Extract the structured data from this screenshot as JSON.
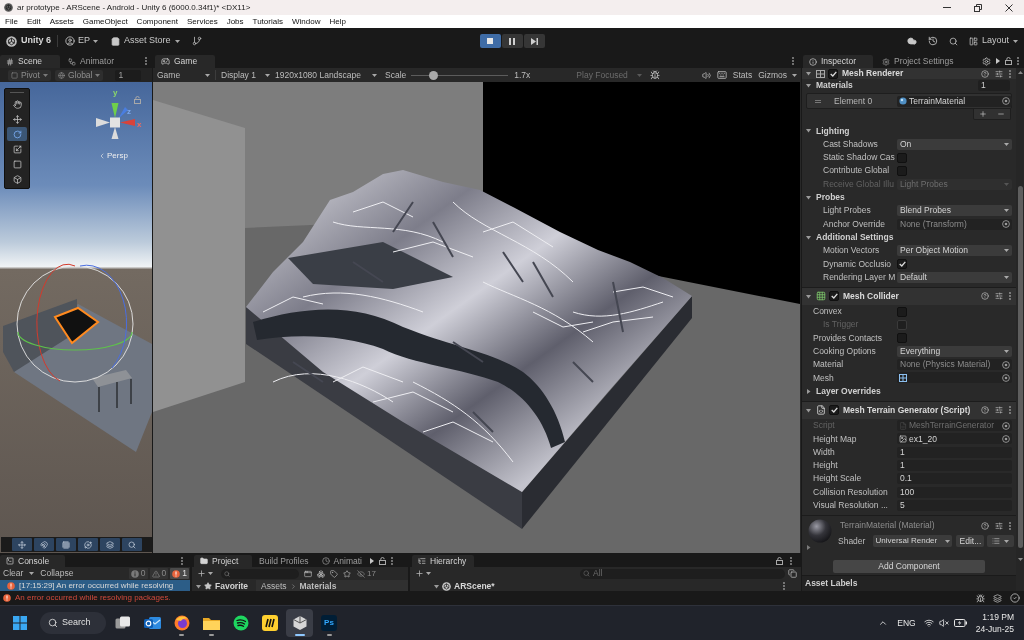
{
  "window": {
    "title": "ar prototype - ARScene - Android - Unity 6 (6000.0.34f1)* <DX11>"
  },
  "menu": [
    "File",
    "Edit",
    "Assets",
    "GameObject",
    "Component",
    "Services",
    "Jobs",
    "Tutorials",
    "Window",
    "Help"
  ],
  "toolbar": {
    "product": "Unity 6",
    "account": "EP",
    "store": "Asset Store",
    "play_controls": [
      {
        "kind": "play",
        "selected": true
      },
      {
        "kind": "pause",
        "selected": false
      },
      {
        "kind": "step",
        "selected": false
      }
    ],
    "layout": "Layout"
  },
  "scene": {
    "tabs": [
      {
        "label": "Scene",
        "kind": "scene",
        "selected": true
      },
      {
        "label": "Animator",
        "kind": "animator",
        "selected": false
      }
    ],
    "pivot": "Pivot",
    "space": "Global",
    "grid_size": "1",
    "tools": [
      {
        "kind": "hand",
        "selected": false
      },
      {
        "kind": "move",
        "selected": false
      },
      {
        "kind": "rotate",
        "selected": true
      },
      {
        "kind": "scale",
        "selected": false
      },
      {
        "kind": "rect",
        "selected": false
      },
      {
        "kind": "transform",
        "selected": false
      }
    ],
    "axis_labels": [
      "y",
      "z",
      "x"
    ],
    "projection": "Persp"
  },
  "game": {
    "tab": {
      "label": "Game",
      "selected": true
    },
    "mode": "Game",
    "display": "Display 1",
    "resolution": "1920x1080 Landscape",
    "scale": {
      "label": "Scale",
      "level": 0.2,
      "reading": "1.7x"
    },
    "play_focused": "Play Focused",
    "stats": "Stats",
    "gizmos": "Gizmos"
  },
  "inspector": {
    "tabs": [
      {
        "label": "Inspector",
        "kind": "info",
        "selected": true
      },
      {
        "label": "Project Settings",
        "kind": "settings",
        "selected": false
      }
    ],
    "components": [
      {
        "name": "Mesh Renderer",
        "kind": "renderer",
        "expanded": true,
        "enabled": true,
        "rows": [
          {
            "kind": "array",
            "label": "Materials",
            "value": "1",
            "expanded": true,
            "children": [
              {
                "kind": "material",
                "label": "Element 0",
                "value": "TerrainMaterial"
              }
            ]
          },
          {
            "kind": "section",
            "label": "Lighting",
            "expanded": true,
            "children": [
              {
                "kind": "dropdown",
                "label": "Cast Shadows",
                "value": "On",
                "disabled": false
              },
              {
                "kind": "checkbox",
                "label": "Static Shadow Cas",
                "checked": false,
                "disabled": false
              },
              {
                "kind": "checkbox",
                "label": "Contribute Global",
                "checked": false,
                "disabled": false
              },
              {
                "kind": "dropdown",
                "label": "Receive Global Illu",
                "value": "Light Probes",
                "disabled": true
              }
            ]
          },
          {
            "kind": "section",
            "label": "Probes",
            "expanded": true,
            "children": [
              {
                "kind": "dropdown",
                "label": "Light Probes",
                "value": "Blend Probes",
                "disabled": false
              },
              {
                "kind": "object",
                "label": "Anchor Override",
                "value": "None (Transform)",
                "disabled": false
              }
            ]
          },
          {
            "kind": "section",
            "label": "Additional Settings",
            "expanded": true,
            "children": [
              {
                "kind": "dropdown",
                "label": "Motion Vectors",
                "value": "Per Object Motion",
                "disabled": false
              },
              {
                "kind": "checkbox",
                "label": "Dynamic Occlusio",
                "checked": true,
                "disabled": false
              },
              {
                "kind": "dropdown",
                "label": "Rendering Layer M",
                "value": "Default",
                "disabled": false
              }
            ]
          }
        ]
      },
      {
        "name": "Mesh Collider",
        "kind": "collider",
        "expanded": true,
        "enabled": true,
        "rows": [
          {
            "kind": "checkbox",
            "label": "Convex",
            "checked": false,
            "disabled": false,
            "children": [
              {
                "kind": "checkbox",
                "label": "Is Trigger",
                "checked": false,
                "disabled": true
              }
            ]
          },
          {
            "kind": "checkbox",
            "label": "Provides Contacts",
            "checked": false,
            "disabled": false
          },
          {
            "kind": "dropdown",
            "label": "Cooking Options",
            "value": "Everything",
            "disabled": false
          },
          {
            "kind": "object",
            "label": "Material",
            "value": "None (Physics Material)",
            "disabled": false
          },
          {
            "kind": "mesh",
            "label": "Mesh",
            "disabled": false
          },
          {
            "kind": "section",
            "label": "Layer Overrides",
            "expanded": false
          }
        ]
      },
      {
        "name": "Mesh Terrain Generator (Script)",
        "kind": "script",
        "expanded": true,
        "enabled": true,
        "rows": [
          {
            "kind": "script",
            "label": "Script",
            "value": "MeshTerrainGenerator",
            "disabled": true
          },
          {
            "kind": "texture",
            "label": "Height Map",
            "value": "ex1_20",
            "disabled": false
          },
          {
            "kind": "number",
            "label": "Width",
            "value": "1",
            "disabled": false
          },
          {
            "kind": "number",
            "label": "Height",
            "value": "1",
            "disabled": false
          },
          {
            "kind": "number",
            "label": "Height Scale",
            "value": "0.1",
            "disabled": false
          },
          {
            "kind": "number",
            "label": "Collision Resolution",
            "value": "100",
            "disabled": false
          },
          {
            "kind": "number",
            "label": "Visual Resolution ...",
            "value": "5",
            "disabled": false
          }
        ]
      }
    ],
    "material": {
      "name": "TerrainMaterial (Material)",
      "expanded": false,
      "shader_label": "Shader",
      "shader": "Universal Render",
      "edit": "Edit..."
    },
    "add_component": "Add Component",
    "asset_labels": "Asset Labels"
  },
  "console": {
    "tab": {
      "label": "Console",
      "selected": true
    },
    "clear": "Clear",
    "collapse": "Collapse",
    "counts": [
      {
        "kind": "info",
        "value": "0"
      },
      {
        "kind": "warning",
        "value": "0"
      },
      {
        "kind": "error",
        "value": "1"
      }
    ],
    "entries": [
      {
        "kind": "error",
        "text": "[17:15:29] An error occurred while resolving",
        "selected": true
      }
    ]
  },
  "project": {
    "tabs": [
      {
        "label": "Project",
        "kind": "project",
        "selected": true
      },
      {
        "label": "Build Profiles",
        "kind": "build",
        "selected": false
      },
      {
        "label": "Animati",
        "kind": "animation",
        "selected": false
      }
    ],
    "hidden_packages": "17",
    "favorites": {
      "label": "Favorite",
      "expanded": true
    },
    "breadcrumb": [
      "Assets",
      "Materials"
    ]
  },
  "hierarchy": {
    "tab": {
      "label": "Hierarchy",
      "selected": true
    },
    "search": {
      "placeholder": "All"
    },
    "scene": {
      "label": "ARScene*",
      "expanded": true
    }
  },
  "status_bar": {
    "message": "An error occurred while resolving packages."
  },
  "taskbar": {
    "search": "Search",
    "apps": [
      {
        "kind": "task-view",
        "running": false,
        "selected": false
      },
      {
        "kind": "mail",
        "running": false,
        "selected": false
      },
      {
        "kind": "browser",
        "running": true,
        "selected": false
      },
      {
        "kind": "folder",
        "running": true,
        "selected": false
      },
      {
        "kind": "music",
        "running": false,
        "selected": false
      },
      {
        "kind": "board",
        "running": false,
        "selected": false
      },
      {
        "kind": "engine",
        "running": true,
        "selected": true
      },
      {
        "kind": "photo",
        "label": "Ps",
        "running": true,
        "selected": false
      }
    ],
    "language": "ENG",
    "time": "1:19 PM",
    "date": "24-Jun-25"
  }
}
